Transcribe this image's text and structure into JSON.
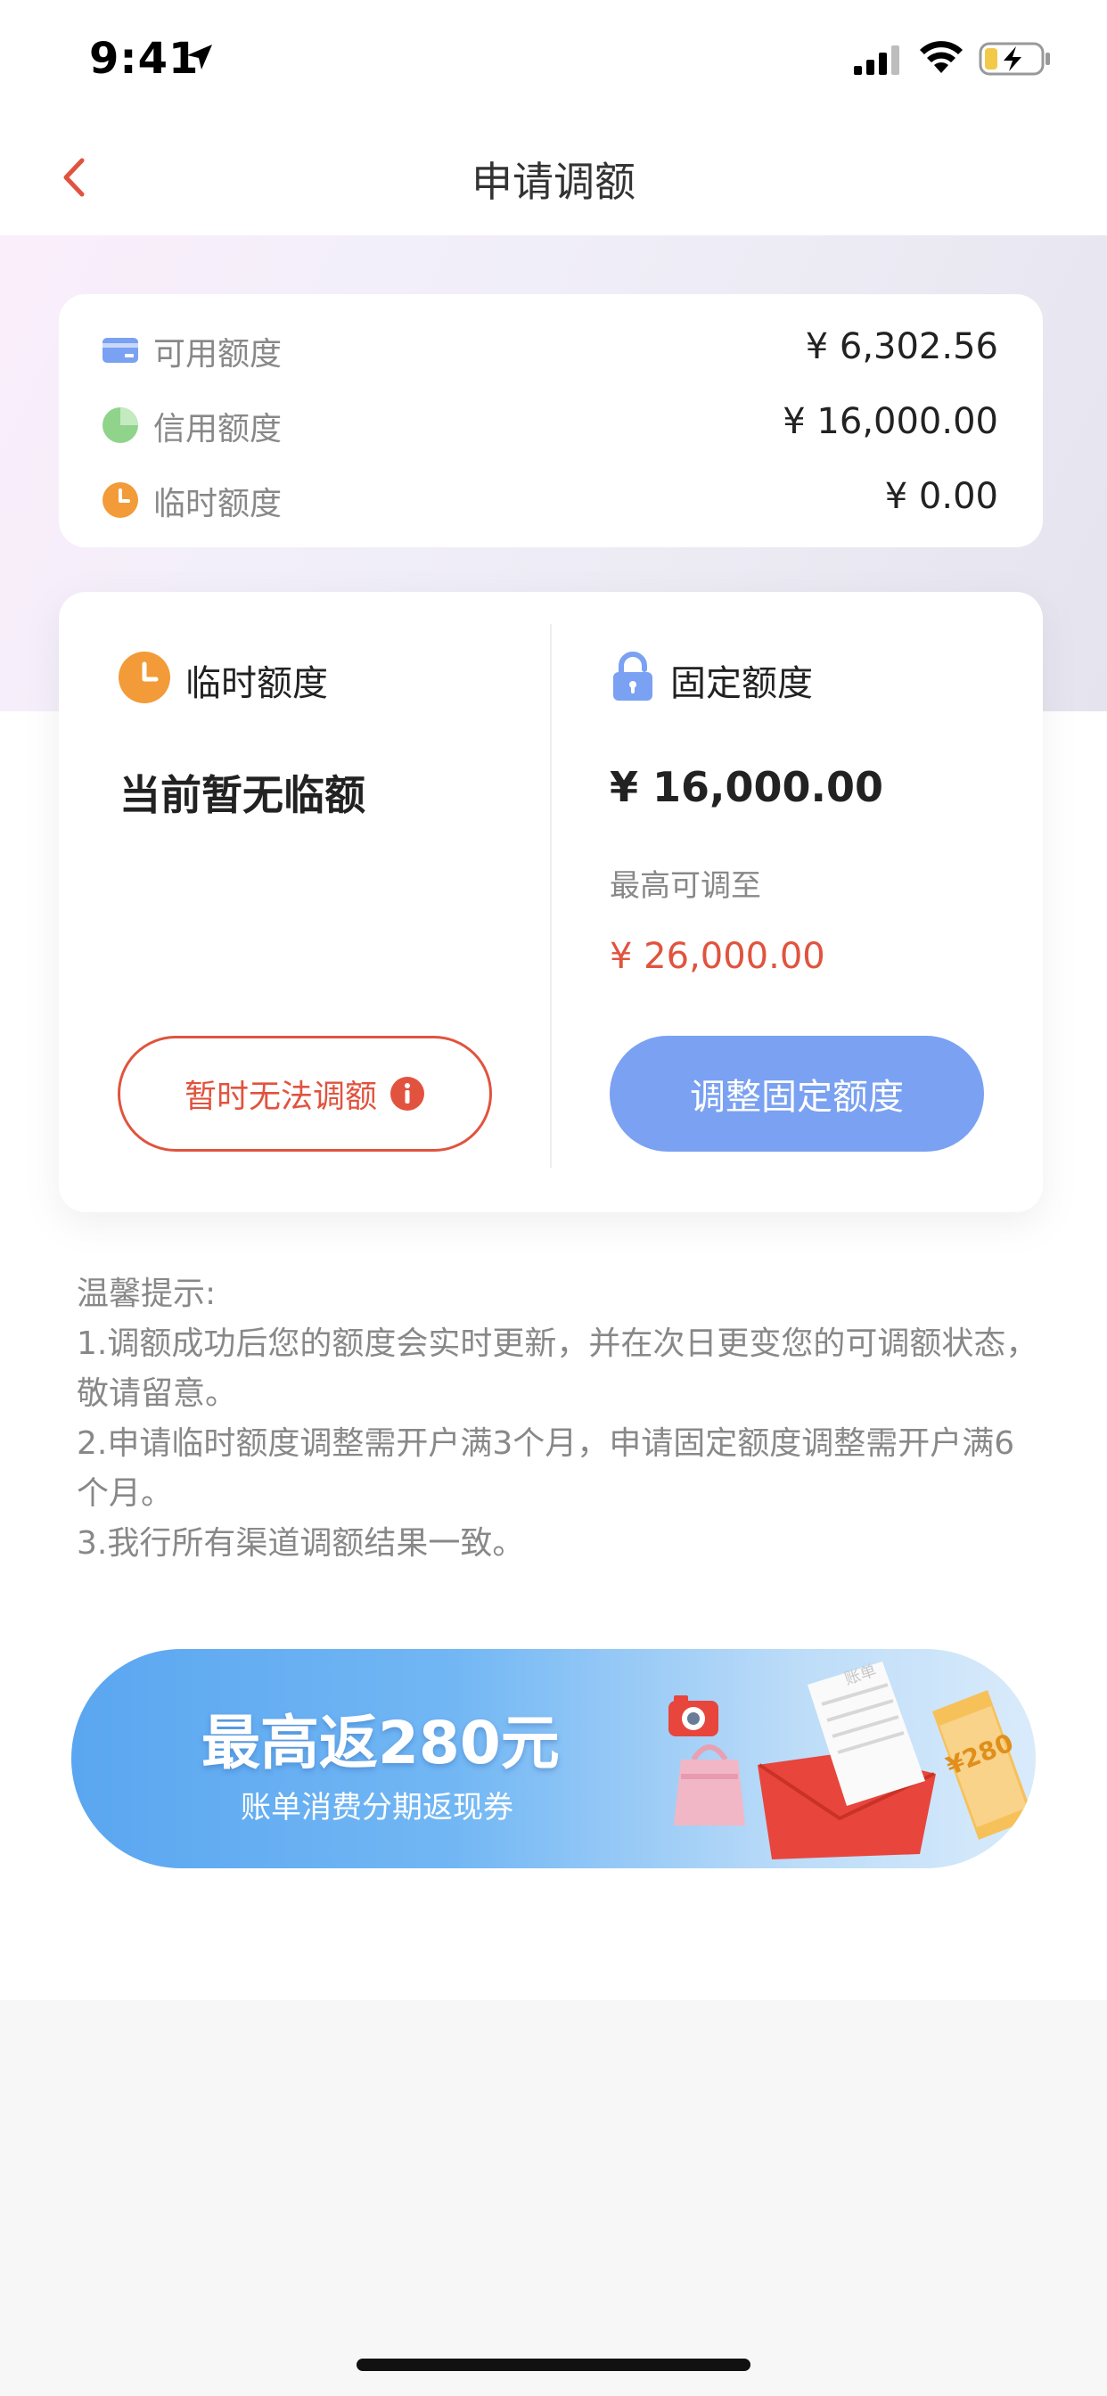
{
  "status_bar": {
    "time": "9:41"
  },
  "nav": {
    "title": "申请调额"
  },
  "summary": {
    "available": {
      "label": "可用额度",
      "value": "¥ 6,302.56"
    },
    "credit": {
      "label": "信用额度",
      "value": "¥ 16,000.00"
    },
    "temporary": {
      "label": "临时额度",
      "value": "¥ 0.00"
    }
  },
  "temporary_col": {
    "title": "临时额度",
    "status": "当前暂无临额",
    "button_label": "暂时无法调额"
  },
  "fixed_col": {
    "title": "固定额度",
    "amount": "¥ 16,000.00",
    "max_label": "最高可调至",
    "max_value": "¥ 26,000.00",
    "button_label": "调整固定额度"
  },
  "tips": {
    "heading": "温馨提示:",
    "items": [
      "1.调额成功后您的额度会实时更新，并在次日更变您的可调额状态，敬请留意。",
      "2.申请临时额度调整需开户满3个月，申请固定额度调整需开户满6个月。",
      "3.我行所有渠道调额结果一致。"
    ]
  },
  "banner": {
    "title": "最高返280元",
    "subtitle": "账单消费分期返现券",
    "art_bill_text": "账单",
    "art_coupon_text": "¥280"
  },
  "colors": {
    "accent_red": "#e1533e",
    "button_blue": "#7aa1f2",
    "orange": "#f29b38",
    "green": "#8fd48a",
    "card_blue": "#7aa1f2"
  },
  "icons": {
    "location": "location-arrow-icon",
    "signal": "cellular-signal-icon",
    "wifi": "wifi-icon",
    "battery": "battery-charging-icon",
    "back": "chevron-left-icon",
    "available": "card-icon",
    "credit": "pie-icon",
    "temporary": "clock-icon",
    "fixed": "lock-icon",
    "info": "info-icon"
  }
}
